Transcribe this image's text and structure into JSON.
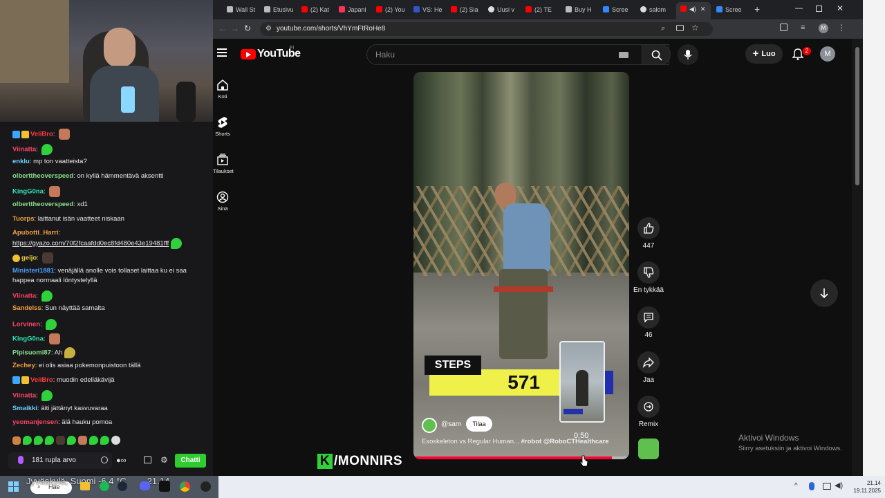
{
  "browser": {
    "tabs": [
      {
        "label": "Wall St",
        "color": "#bbbbbb"
      },
      {
        "label": "Etusivu",
        "color": "#bbbbbb"
      },
      {
        "label": "(2) Kat",
        "color": "#ff0000"
      },
      {
        "label": "Japani",
        "color": "#ff3355"
      },
      {
        "label": "(2) You",
        "color": "#ff0000"
      },
      {
        "label": "VS: He",
        "color": "#3355cc"
      },
      {
        "label": "(2) Sia",
        "color": "#ff0000"
      },
      {
        "label": "Uusi v",
        "color": "#dddddd"
      },
      {
        "label": "(2) TE",
        "color": "#ff0000"
      },
      {
        "label": "Buy H",
        "color": "#bbbbbb"
      },
      {
        "label": "Scree",
        "color": "#3388ff"
      },
      {
        "label": "salom",
        "color": "#dddddd"
      },
      {
        "label": "",
        "color": "#ff0000"
      },
      {
        "label": "Scree",
        "color": "#3388ff"
      }
    ],
    "url": "youtube.com/shorts/VhYmFtRoHe8"
  },
  "youtube": {
    "logo": "YouTube",
    "country": "FI",
    "search_placeholder": "Haku",
    "create_label": "Luo",
    "notification_count": "2",
    "avatar_letter": "M",
    "nav": [
      {
        "label": "Koti",
        "icon": "home-icon"
      },
      {
        "label": "Shorts",
        "icon": "shorts-icon"
      },
      {
        "label": "Tilaukset",
        "icon": "subscriptions-icon"
      },
      {
        "label": "Sinä",
        "icon": "you-icon"
      }
    ],
    "short": {
      "overlay_label": "STEPS",
      "overlay_count": "571",
      "channel": "@sam",
      "subscribe_label": "Tilaa",
      "duration": "0:50",
      "title": "Exoskeleton vs Regular Human...",
      "title_tags": "#robot @RoboCTHealthcare",
      "progress": 0.92
    },
    "actions": {
      "likes": "447",
      "dislike_label": "En tykkää",
      "comments": "46",
      "share_label": "Jaa",
      "remix_label": "Remix"
    },
    "activate_title": "Aktivoi Windows",
    "activate_sub": "Siirry asetuksiin ja aktivoi Windows."
  },
  "chat": {
    "messages": [
      {
        "user": "VeliBro",
        "color": "#ff3b3b",
        "text": "",
        "emote": "face"
      },
      {
        "user": "Viinatta",
        "color": "#ff4466",
        "text": "",
        "emote": "green"
      },
      {
        "user": "enklu",
        "color": "#6bd0ff",
        "text": "mp ton vaatteista?",
        "emote": ""
      },
      {
        "user": "olberttheoverspeed",
        "color": "#8be08b",
        "text": "on kyllä hämmentävä aksentti",
        "emote": ""
      },
      {
        "user": "KingG0na",
        "color": "#2ee6b6",
        "text": "",
        "emote": "face"
      },
      {
        "user": "olberttheoverspeed",
        "color": "#8be08b",
        "text": "xd1",
        "emote": ""
      },
      {
        "user": "Tuorps",
        "color": "#f0a040",
        "text": "laittanut isän vaatteet niskaan",
        "emote": ""
      },
      {
        "user": "Apubotti_Harri",
        "color": "#f0a040",
        "text": "",
        "emote": ""
      },
      {
        "user": "",
        "color": "#ffffff",
        "text": "https://gyazo.com/70f2fcaafdd0ec8fd480e43e19481fff",
        "emote": "green"
      },
      {
        "user": "geijo",
        "color": "#f0d040",
        "text": "",
        "emote": "dark"
      },
      {
        "user": "Ministeri1881",
        "color": "#4aa0ff",
        "text": "venäjällä anolle vois tollaset laittaa ku ei saa",
        "emote": ""
      },
      {
        "user": "",
        "color": "#ffffff",
        "text": "happea normaali löntystelyllä",
        "emote": ""
      },
      {
        "user": "Viinatta",
        "color": "#ff4466",
        "text": "",
        "emote": "green"
      },
      {
        "user": "Sandelss",
        "color": "#f0a040",
        "text": "Sun näyttää samalta",
        "emote": ""
      },
      {
        "user": "Lorvinen",
        "color": "#ff4466",
        "text": "",
        "emote": "green"
      },
      {
        "user": "KingG0na",
        "color": "#2ee6b6",
        "text": "",
        "emote": "face"
      },
      {
        "user": "Pipisuomi87",
        "color": "#8be08b",
        "text": "Ah",
        "emote": "green"
      },
      {
        "user": "Zechey",
        "color": "#f0a040",
        "text": "ei olis asiaa pokemonpuistoon tällä",
        "emote": ""
      },
      {
        "user": "VeliBro",
        "color": "#ff3b3b",
        "text": "muodin edelläkävijä",
        "emote": ""
      },
      {
        "user": "Viinatta",
        "color": "#ff4466",
        "text": "",
        "emote": "green"
      },
      {
        "user": "Smaikki",
        "color": "#6bd0ff",
        "text": "äiti jättänyt kasvuvaraa",
        "emote": ""
      },
      {
        "user": "yeomanjensen",
        "color": "#ff4466",
        "text": "älä hauku pomoa",
        "emote": ""
      }
    ],
    "points": "181 rupla arvo",
    "chat_button": "Chatti"
  },
  "watermark": "/MONNIRS",
  "watermark_k": "K",
  "taskbar": {
    "weather": "Jyväskylä, Suomi   -6,4 °C",
    "weather_time": "21.14",
    "search": "Hae",
    "time": "21.14",
    "date": "19.11.2025"
  }
}
